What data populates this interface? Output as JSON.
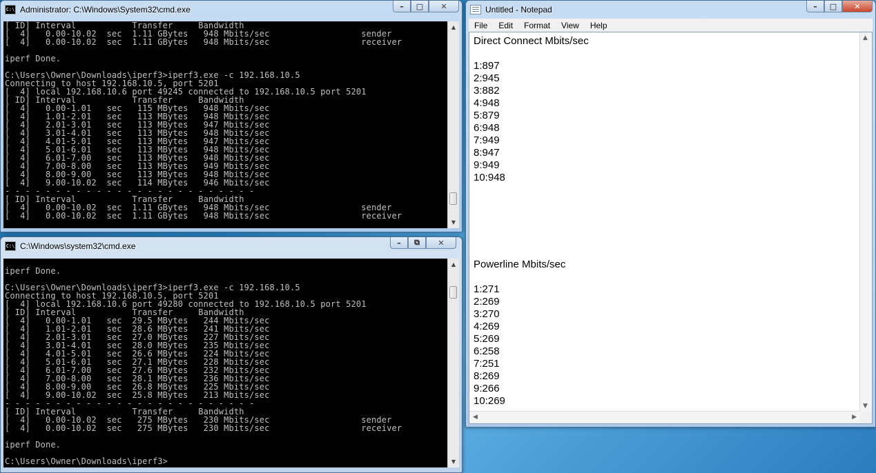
{
  "cmd_admin": {
    "title": "Administrator: C:\\Windows\\System32\\cmd.exe",
    "icon_label": "C:\\",
    "lines": [
      "[ ID] Interval           Transfer     Bandwidth",
      "[  4]   0.00-10.02  sec  1.11 GBytes   948 Mbits/sec                  sender",
      "[  4]   0.00-10.02  sec  1.11 GBytes   948 Mbits/sec                  receiver",
      "",
      "iperf Done.",
      "",
      "C:\\Users\\Owner\\Downloads\\iperf3>iperf3.exe -c 192.168.10.5",
      "Connecting to host 192.168.10.5, port 5201",
      "[  4] local 192.168.10.6 port 49245 connected to 192.168.10.5 port 5201",
      "[ ID] Interval           Transfer     Bandwidth",
      "[  4]   0.00-1.01   sec   115 MBytes   948 Mbits/sec",
      "[  4]   1.01-2.01   sec   113 MBytes   948 Mbits/sec",
      "[  4]   2.01-3.01   sec   113 MBytes   947 Mbits/sec",
      "[  4]   3.01-4.01   sec   113 MBytes   948 Mbits/sec",
      "[  4]   4.01-5.01   sec   113 MBytes   947 Mbits/sec",
      "[  4]   5.01-6.01   sec   113 MBytes   948 Mbits/sec",
      "[  4]   6.01-7.00   sec   113 MBytes   948 Mbits/sec",
      "[  4]   7.00-8.00   sec   113 MBytes   949 Mbits/sec",
      "[  4]   8.00-9.00   sec   113 MBytes   948 Mbits/sec",
      "[  4]   9.00-10.02  sec   114 MBytes   946 Mbits/sec",
      "- - - - - - - - - - - - - - - - - - - - - - - - -",
      "[ ID] Interval           Transfer     Bandwidth",
      "[  4]   0.00-10.02  sec  1.11 GBytes   948 Mbits/sec                  sender",
      "[  4]   0.00-10.02  sec  1.11 GBytes   948 Mbits/sec                  receiver"
    ]
  },
  "cmd_user": {
    "title": "C:\\Windows\\system32\\cmd.exe",
    "icon_label": "C:\\",
    "lines": [
      "",
      "iperf Done.",
      "",
      "C:\\Users\\Owner\\Downloads\\iperf3>iperf3.exe -c 192.168.10.5",
      "Connecting to host 192.168.10.5, port 5201",
      "[  4] local 192.168.10.6 port 49280 connected to 192.168.10.5 port 5201",
      "[ ID] Interval           Transfer     Bandwidth",
      "[  4]   0.00-1.01   sec  29.5 MBytes   244 Mbits/sec",
      "[  4]   1.01-2.01   sec  28.6 MBytes   241 Mbits/sec",
      "[  4]   2.01-3.01   sec  27.0 MBytes   227 Mbits/sec",
      "[  4]   3.01-4.01   sec  28.0 MBytes   235 Mbits/sec",
      "[  4]   4.01-5.01   sec  26.6 MBytes   224 Mbits/sec",
      "[  4]   5.01-6.01   sec  27.1 MBytes   228 Mbits/sec",
      "[  4]   6.01-7.00   sec  27.6 MBytes   232 Mbits/sec",
      "[  4]   7.00-8.00   sec  28.1 MBytes   236 Mbits/sec",
      "[  4]   8.00-9.00   sec  26.8 MBytes   225 Mbits/sec",
      "[  4]   9.00-10.02  sec  25.8 MBytes   213 Mbits/sec",
      "- - - - - - - - - - - - - - - - - - - - - - - - -",
      "[ ID] Interval           Transfer     Bandwidth",
      "[  4]   0.00-10.02  sec   275 MBytes   230 Mbits/sec                  sender",
      "[  4]   0.00-10.02  sec   275 MBytes   230 Mbits/sec                  receiver",
      "",
      "iperf Done.",
      "",
      "C:\\Users\\Owner\\Downloads\\iperf3>"
    ]
  },
  "notepad": {
    "title": "Untitled - Notepad",
    "menu": [
      "File",
      "Edit",
      "Format",
      "View",
      "Help"
    ],
    "content": "Direct Connect Mbits/sec\n\n1:897\n2:945\n3:882\n4:948\n5:879\n6:948\n7:949\n8:947\n9:949\n10:948\n\n\n\n\n\n\nPowerline Mbits/sec\n\n1:271\n2:269\n3:270\n4:269\n5:269\n6:258\n7:251\n8:269\n9:266\n10:269"
  },
  "window_controls": {
    "minimize": "–",
    "maximize": "□",
    "restore": "⧉",
    "close": "✕"
  },
  "scroll_arrows": {
    "up": "▲",
    "down": "▼",
    "left": "◀",
    "right": "▶"
  }
}
